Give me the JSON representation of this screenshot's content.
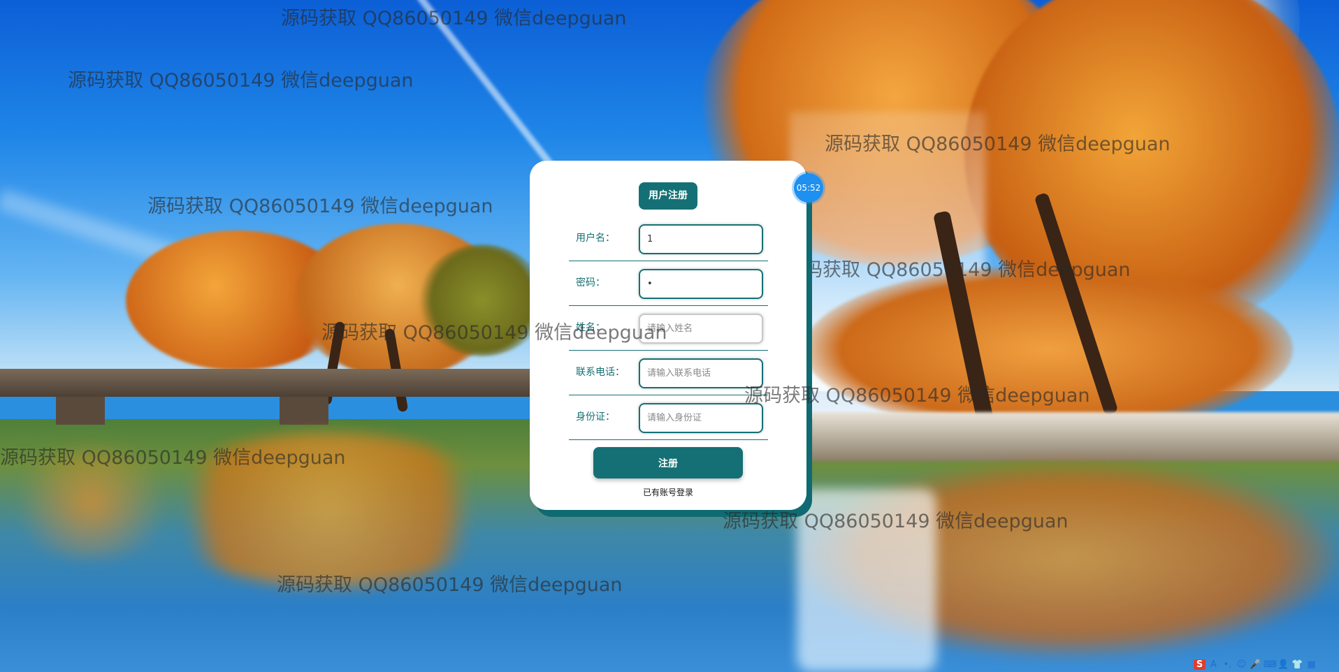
{
  "watermark": {
    "text": "源码获取 QQ86050149 微信deepguan"
  },
  "card": {
    "title": "用户注册",
    "timer": "05:52",
    "fields": [
      {
        "label": "用户名：",
        "value": "1",
        "placeholder": ""
      },
      {
        "label": "密码：",
        "value": "•",
        "placeholder": ""
      },
      {
        "label": "姓名：",
        "value": "",
        "placeholder": "请输入姓名"
      },
      {
        "label": "联系电话：",
        "value": "",
        "placeholder": "请输入联系电话"
      },
      {
        "label": "身份证：",
        "value": "",
        "placeholder": "请输入身份证"
      }
    ],
    "submit_label": "注册",
    "login_link": "已有账号登录"
  },
  "ime_toolbar": {
    "logo": "S",
    "items": [
      "A",
      "•,",
      "☺",
      "🎤",
      "⌨",
      "👤",
      "👕",
      "▦"
    ]
  },
  "colors": {
    "accent": "#147075",
    "timer": "#1e90f0"
  }
}
